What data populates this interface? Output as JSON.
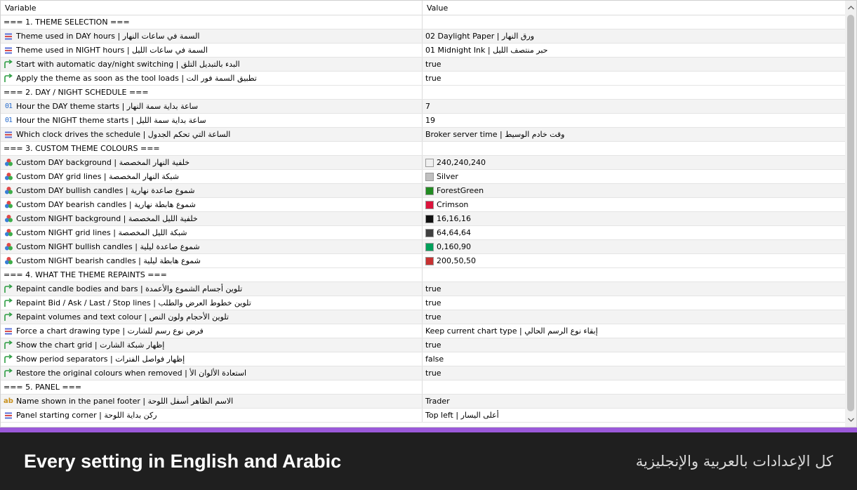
{
  "header": {
    "variable": "Variable",
    "value": "Value"
  },
  "colors": {
    "accent": "#9b59d9",
    "banner_bg": "#1f1f1f",
    "row_alt": "#f3f3f3"
  },
  "rows": [
    {
      "type": "section",
      "label": "=== 1. THEME SELECTION ==="
    },
    {
      "type": "param",
      "icon": "enum",
      "label": "Theme used in DAY hours | السمة في ساعات النهار",
      "value": "02 Daylight Paper | ورق النهار"
    },
    {
      "type": "param",
      "icon": "enum",
      "label": "Theme used in NIGHT hours | السمة في ساعات الليل",
      "value": "01 Midnight Ink | حبر منتصف الليل"
    },
    {
      "type": "param",
      "icon": "bool",
      "label": "Start with automatic day/night switching | البدء بالتبديل التلق",
      "value": "true"
    },
    {
      "type": "param",
      "icon": "bool",
      "label": "Apply the theme as soon as the tool loads | تطبيق السمة فور الت",
      "value": "true"
    },
    {
      "type": "section",
      "label": "=== 2. DAY / NIGHT SCHEDULE ==="
    },
    {
      "type": "param",
      "icon": "int",
      "label": "Hour the DAY theme starts | ساعة بداية سمة النهار",
      "value": "7"
    },
    {
      "type": "param",
      "icon": "int",
      "label": "Hour the NIGHT theme starts | ساعة بداية سمة الليل",
      "value": "19"
    },
    {
      "type": "param",
      "icon": "enum",
      "label": "Which clock drives the schedule | الساعة التي تحكم الجدول",
      "value": "Broker server time | وقت خادم الوسيط"
    },
    {
      "type": "section",
      "label": "=== 3. CUSTOM THEME COLOURS ==="
    },
    {
      "type": "param",
      "icon": "color",
      "label": "Custom DAY background | خلفية النهار المخصصة",
      "value": "240,240,240",
      "swatch": "#f0f0f0"
    },
    {
      "type": "param",
      "icon": "color",
      "label": "Custom DAY grid lines | شبكة النهار المخصصة",
      "value": "Silver",
      "swatch": "#c0c0c0"
    },
    {
      "type": "param",
      "icon": "color",
      "label": "Custom DAY bullish candles | شموع صاعدة نهارية",
      "value": "ForestGreen",
      "swatch": "#228b22"
    },
    {
      "type": "param",
      "icon": "color",
      "label": "Custom DAY bearish candles | شموع هابطة نهارية",
      "value": "Crimson",
      "swatch": "#dc143c"
    },
    {
      "type": "param",
      "icon": "color",
      "label": "Custom NIGHT background | خلفية الليل المخصصة",
      "value": "16,16,16",
      "swatch": "#101010"
    },
    {
      "type": "param",
      "icon": "color",
      "label": "Custom NIGHT grid lines | شبكة الليل المخصصة",
      "value": "64,64,64",
      "swatch": "#404040"
    },
    {
      "type": "param",
      "icon": "color",
      "label": "Custom NIGHT bullish candles | شموع صاعدة ليلية",
      "value": "0,160,90",
      "swatch": "#00a05a"
    },
    {
      "type": "param",
      "icon": "color",
      "label": "Custom NIGHT bearish candles | شموع هابطة ليلية",
      "value": "200,50,50",
      "swatch": "#c83232"
    },
    {
      "type": "section",
      "label": "=== 4. WHAT THE THEME REPAINTS ==="
    },
    {
      "type": "param",
      "icon": "bool",
      "label": "Repaint candle bodies and bars | تلوين أجسام الشموع والأعمدة",
      "value": "true"
    },
    {
      "type": "param",
      "icon": "bool",
      "label": "Repaint Bid / Ask / Last / Stop lines | تلوين خطوط العرض والطلب",
      "value": "true"
    },
    {
      "type": "param",
      "icon": "bool",
      "label": "Repaint volumes and text colour | تلوين الأحجام ولون النص",
      "value": "true"
    },
    {
      "type": "param",
      "icon": "enum",
      "label": "Force a chart drawing type | فرض نوع رسم للشارت",
      "value": "Keep current chart type | إبقاء نوع الرسم الحالي"
    },
    {
      "type": "param",
      "icon": "bool",
      "label": "Show the chart grid | إظهار شبكة الشارت",
      "value": "true"
    },
    {
      "type": "param",
      "icon": "bool",
      "label": "Show period separators | إظهار فواصل الفترات",
      "value": "false"
    },
    {
      "type": "param",
      "icon": "bool",
      "label": "Restore the original colours when removed | استعادة الألوان الأ",
      "value": "true"
    },
    {
      "type": "section",
      "label": "=== 5. PANEL ==="
    },
    {
      "type": "param",
      "icon": "string",
      "label": "Name shown in the panel footer | الاسم الظاهر أسفل اللوحة",
      "value": "Trader"
    },
    {
      "type": "param",
      "icon": "enum",
      "label": "Panel starting corner | ركن بداية اللوحة",
      "value": "Top left | أعلى اليسار"
    }
  ],
  "banner": {
    "english": "Every setting in English and Arabic",
    "arabic": "كل الإعدادات بالعربية والإنجليزية"
  }
}
